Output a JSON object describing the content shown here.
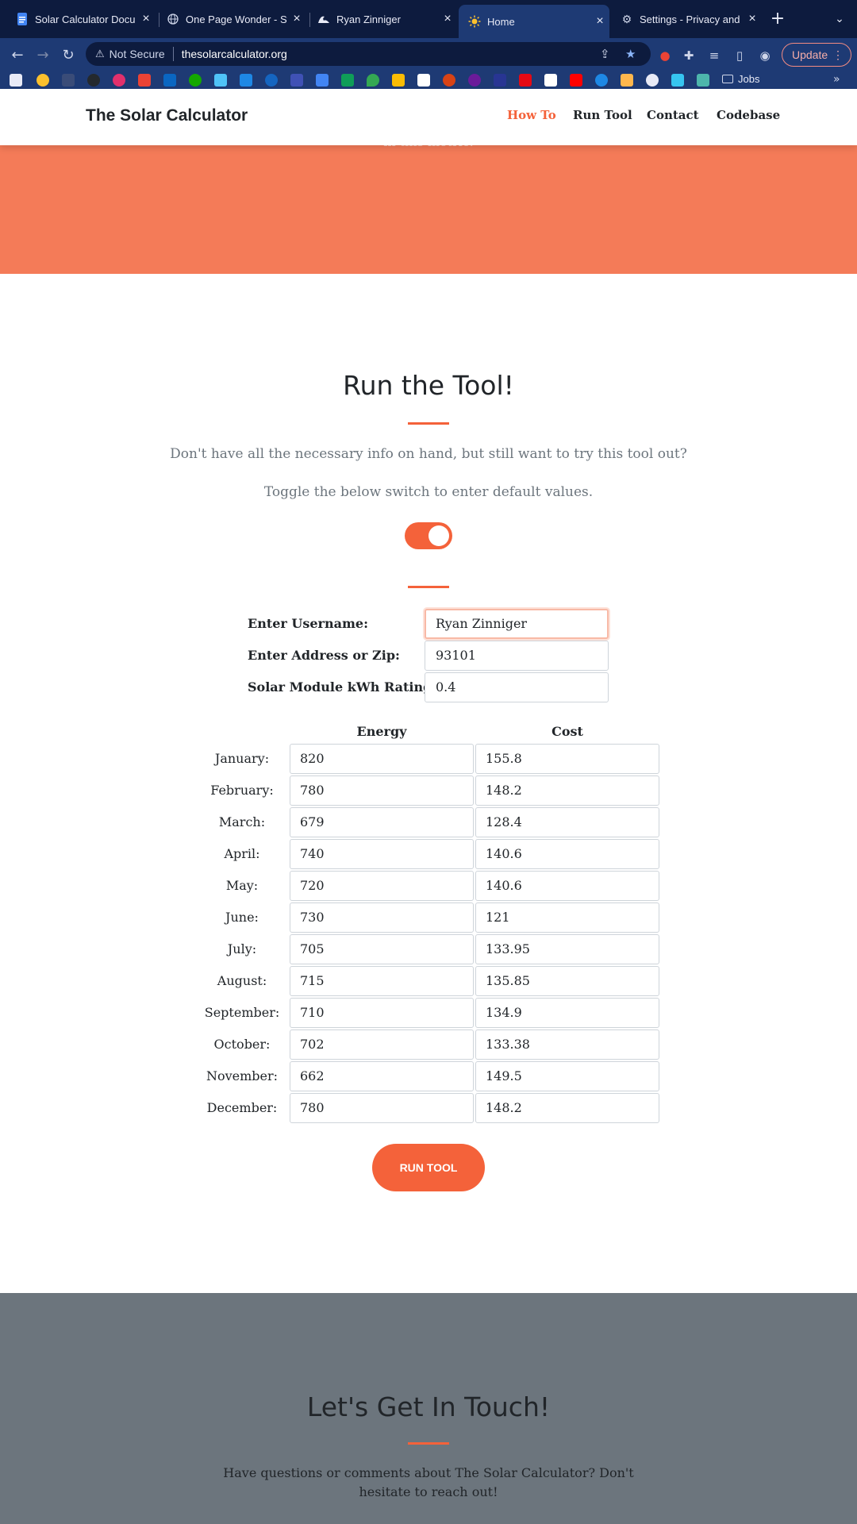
{
  "browser": {
    "tabs": [
      {
        "title": "Solar Calculator Docu",
        "icon": "docs-icon"
      },
      {
        "title": "One Page Wonder - St",
        "icon": "globe-icon"
      },
      {
        "title": "Ryan Zinniger",
        "icon": "wave-icon"
      },
      {
        "title": "Home",
        "icon": "sun-icon"
      },
      {
        "title": "Settings - Privacy and",
        "icon": "gear-icon"
      }
    ],
    "security_label": "Not Secure",
    "url": "thesolarcalculator.org",
    "update_label": "Update",
    "bookmark_folder": "Jobs"
  },
  "site": {
    "brand": "The Solar Calculator",
    "nav": [
      "How To",
      "Run Tool",
      "Contact",
      "Codebase"
    ],
    "hero_text": "in this metric."
  },
  "tool": {
    "title": "Run the Tool!",
    "intro_1": "Don't have all the necessary info on hand, but still want to try this tool out?",
    "intro_2": "Toggle the below switch to enter default values.",
    "toggle_on": true,
    "fields": [
      {
        "label": "Enter Username:",
        "value": "Ryan Zinniger"
      },
      {
        "label": "Enter Address or Zip:",
        "value": "93101"
      },
      {
        "label": "Solar Module kWh Rating*:",
        "value": "0.4"
      }
    ],
    "table_headers": [
      "Energy",
      "Cost"
    ],
    "months": [
      {
        "name": "January:",
        "energy": "820",
        "cost": "155.8"
      },
      {
        "name": "February:",
        "energy": "780",
        "cost": "148.2"
      },
      {
        "name": "March:",
        "energy": "679",
        "cost": "128.4"
      },
      {
        "name": "April:",
        "energy": "740",
        "cost": "140.6"
      },
      {
        "name": "May:",
        "energy": "720",
        "cost": "140.6"
      },
      {
        "name": "June:",
        "energy": "730",
        "cost": "121"
      },
      {
        "name": "July:",
        "energy": "705",
        "cost": "133.95"
      },
      {
        "name": "August:",
        "energy": "715",
        "cost": "135.85"
      },
      {
        "name": "September:",
        "energy": "710",
        "cost": "134.9"
      },
      {
        "name": "October:",
        "energy": "702",
        "cost": "133.38"
      },
      {
        "name": "November:",
        "energy": "662",
        "cost": "149.5"
      },
      {
        "name": "December:",
        "energy": "780",
        "cost": "148.2"
      }
    ],
    "run_button": "RUN TOOL"
  },
  "contact": {
    "title": "Let's Get In Touch!",
    "text": "Have questions or comments about The Solar Calculator? Don't hesitate to reach out!"
  },
  "colors": {
    "accent": "#f4623a",
    "hero": "#f47b58",
    "contact_bg": "#6c757d",
    "chrome_dark": "#0d1b3e",
    "chrome": "#1e3a74"
  }
}
